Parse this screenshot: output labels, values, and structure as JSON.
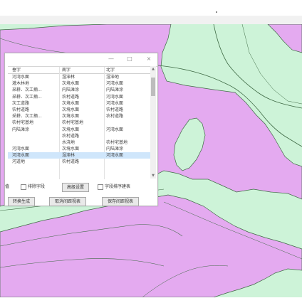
{
  "dialog": {
    "controls": {
      "minimize": "—",
      "maximize": "□",
      "close": "×"
    },
    "columns": [
      "垂字",
      "南字",
      "北字"
    ],
    "rows": [
      [
        "河湾水面",
        "湿滞林",
        "湿滞地"
      ],
      [
        "灌木林地",
        "次境水面",
        "河湾水面"
      ],
      [
        "采耕、次工摘...",
        "内陆滩涂",
        "内陆滩涂"
      ],
      [
        "采耕、次工摘...",
        "农村道路",
        "河湾水面"
      ],
      [
        "次工道路",
        "次境水面",
        "河湾水面"
      ],
      [
        "农村道路",
        "次境水面",
        "农村道路"
      ],
      [
        "采耕、次工摘...",
        "次境水面",
        "农村道路"
      ],
      [
        "农村宅基地",
        "农村宅基地",
        ""
      ],
      [
        "内陆滩涂",
        "次境水面",
        "河湾水面"
      ],
      [
        "",
        "农村道路",
        ""
      ],
      [
        "",
        "水浇地",
        "农村宅基地"
      ],
      [
        "河湾水面",
        "次境水面",
        "内陆滩涂"
      ],
      [
        "河湾水面",
        "湿滞林",
        "河湾水面"
      ],
      [
        "河道地",
        "农村道路",
        ""
      ]
    ],
    "selected_row": 12,
    "options": {
      "left_fragment": "值",
      "check1_label": "排除字段",
      "advanced_button": "高级设置",
      "check2_label": "字段排序建表"
    },
    "buttons": {
      "start": "转换生成",
      "export_current": "取消间距视表",
      "export_all": "保存间距视表"
    }
  },
  "map_colors": {
    "pink": "#e4aaf0",
    "green": "#cdf3d8",
    "line": "#3f6a45"
  }
}
